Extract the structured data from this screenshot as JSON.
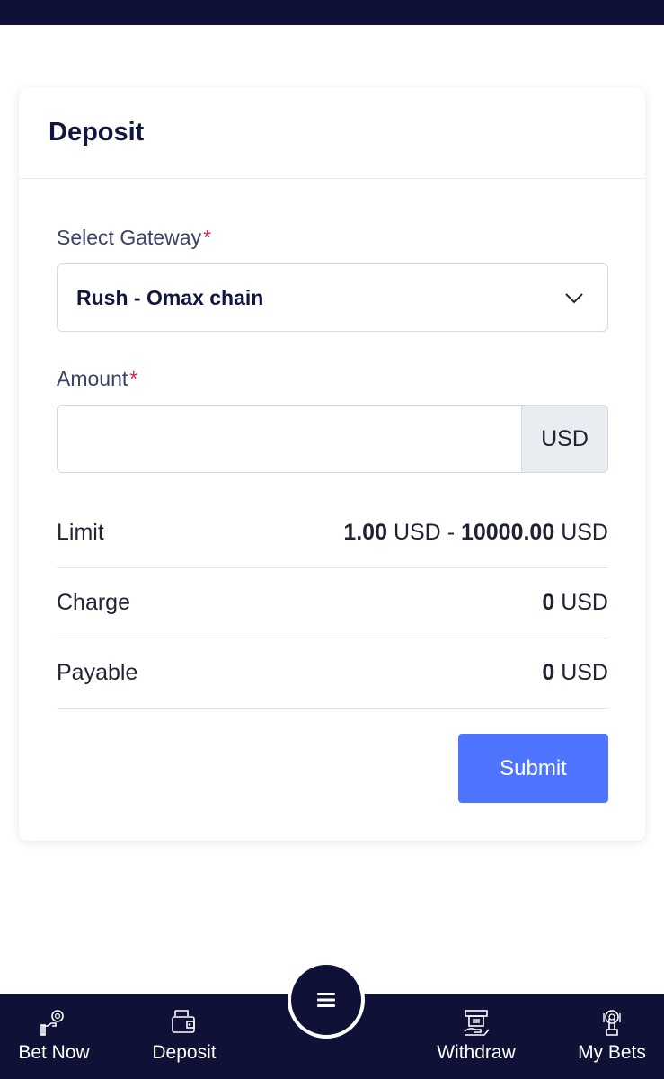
{
  "deposit": {
    "title": "Deposit",
    "gateway_label": "Select Gateway",
    "required_mark": "*",
    "gateway_value": "Rush - Omax chain",
    "amount_label": "Amount",
    "amount_value": "",
    "amount_unit": "USD",
    "limit": {
      "label": "Limit",
      "min": "1.00",
      "max": "10000.00",
      "unit": "USD",
      "separator": "-"
    },
    "charge": {
      "label": "Charge",
      "value": "0",
      "unit": "USD"
    },
    "payable": {
      "label": "Payable",
      "value": "0",
      "unit": "USD"
    },
    "submit_label": "Submit"
  },
  "nav": {
    "items": [
      {
        "label": "Bet Now",
        "icon": "bet-now-icon"
      },
      {
        "label": "Deposit",
        "icon": "wallet-icon"
      },
      {
        "label": "Withdraw",
        "icon": "withdraw-icon"
      },
      {
        "label": "My Bets",
        "icon": "my-bets-icon"
      }
    ],
    "menu_icon": "menu-icon"
  },
  "colors": {
    "navy": "#0f1136",
    "primary": "#4f74ff",
    "required": "#d7274e"
  }
}
